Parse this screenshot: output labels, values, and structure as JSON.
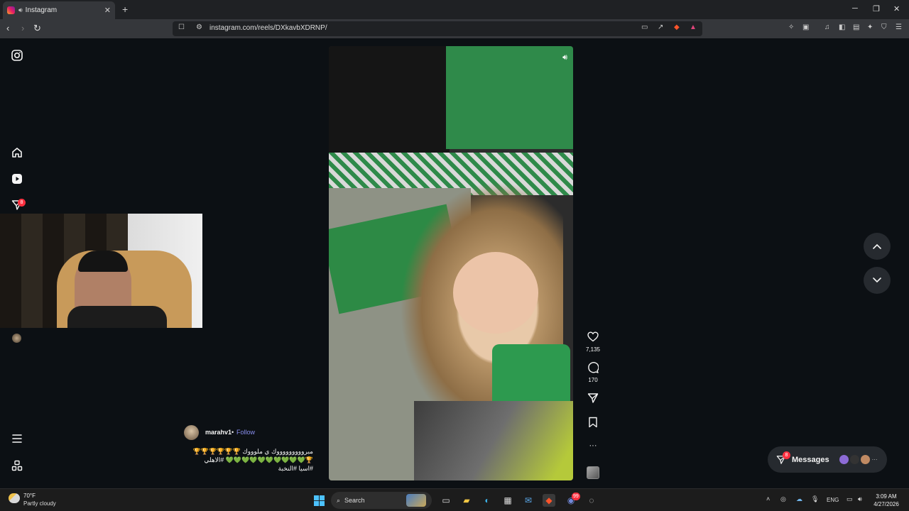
{
  "browser": {
    "tab_title": "Instagram",
    "new_tab": "+",
    "url": "instagram.com/reels/DXkavbXDRNP/",
    "window_controls": {
      "minimize": "─",
      "restore": "❐",
      "close": "✕"
    }
  },
  "instagram": {
    "sidebar": {
      "notifications_badge": "8"
    },
    "reel": {
      "likes": "7,135",
      "comments": "170",
      "more": "···"
    },
    "caption": {
      "username": "marahv1",
      "separator": "•",
      "follow": "Follow",
      "line1": "مبروووووووووك ي ملوووك 🏆🏆🏆🏆🏆🏆",
      "line2": "🏆💚💚💚💚💚💚💚💚💚💚 #الاهلي",
      "line3": "#اسيا #النخبة"
    },
    "messages": {
      "label": "Messages",
      "badge": "8",
      "more": "···"
    }
  },
  "taskbar": {
    "weather_temp": "70°F",
    "weather_desc": "Partly cloudy",
    "search_placeholder": "Search",
    "language": "ENG",
    "time": "3:09 AM",
    "date": "4/27/2026",
    "discord_badge": "99"
  },
  "colors": {
    "page_bg": "#0c1014",
    "link_blue": "#8a8ff0",
    "badge_red": "#ff3040"
  }
}
